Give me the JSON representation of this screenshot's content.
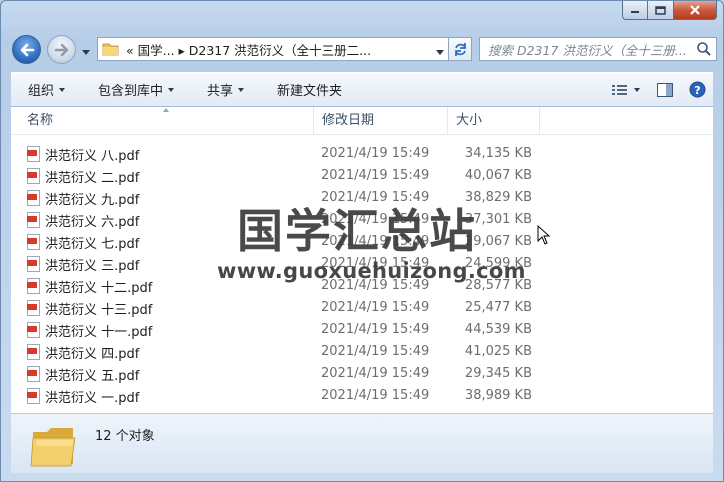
{
  "address": {
    "path_text": "«  国学...  ▸  D2317 洪范衍义（全十三册二..."
  },
  "search": {
    "placeholder": "搜索 D2317 洪范衍义（全十三册..."
  },
  "toolbar": {
    "organize": "组织",
    "include_library": "包含到库中",
    "share": "共享",
    "new_folder": "新建文件夹"
  },
  "columns": {
    "name": "名称",
    "date": "修改日期",
    "size": "大小"
  },
  "files": [
    {
      "name": "洪范衍义 八.pdf",
      "date": "2021/4/19 15:49",
      "size": "34,135 KB"
    },
    {
      "name": "洪范衍义 二.pdf",
      "date": "2021/4/19 15:49",
      "size": "40,067 KB"
    },
    {
      "name": "洪范衍义 九.pdf",
      "date": "2021/4/19 15:49",
      "size": "38,829 KB"
    },
    {
      "name": "洪范衍义 六.pdf",
      "date": "2021/4/19 15:49",
      "size": "37,301 KB"
    },
    {
      "name": "洪范衍义 七.pdf",
      "date": "2021/4/19 15:49",
      "size": "29,067 KB"
    },
    {
      "name": "洪范衍义 三.pdf",
      "date": "2021/4/19 15:49",
      "size": "24,599 KB"
    },
    {
      "name": "洪范衍义 十二.pdf",
      "date": "2021/4/19 15:49",
      "size": "28,577 KB"
    },
    {
      "name": "洪范衍义 十三.pdf",
      "date": "2021/4/19 15:49",
      "size": "25,477 KB"
    },
    {
      "name": "洪范衍义 十一.pdf",
      "date": "2021/4/19 15:49",
      "size": "44,539 KB"
    },
    {
      "name": "洪范衍义 四.pdf",
      "date": "2021/4/19 15:49",
      "size": "41,025 KB"
    },
    {
      "name": "洪范衍义 五.pdf",
      "date": "2021/4/19 15:49",
      "size": "29,345 KB"
    },
    {
      "name": "洪范衍义 一.pdf",
      "date": "2021/4/19 15:49",
      "size": "38,989 KB"
    }
  ],
  "watermark": {
    "title": "国学汇总站",
    "url": "www.guoxuehuizong.com"
  },
  "details": {
    "count": "12 个对象"
  },
  "icons": {
    "file": "pdf-file-icon",
    "folder": "folder-icon",
    "search": "search-icon",
    "refresh": "refresh-icon",
    "help": "help-icon"
  },
  "colors": {
    "frame": "#b9d1ea",
    "pdf_red": "#d53a2b",
    "help_blue": "#2a66b8"
  }
}
